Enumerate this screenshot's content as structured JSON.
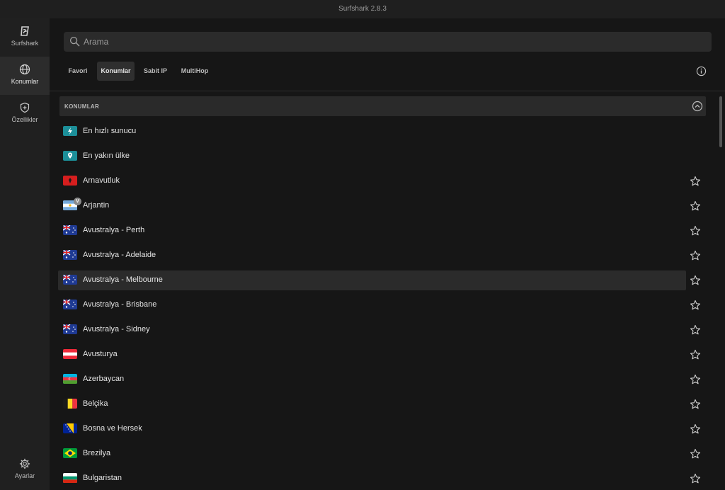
{
  "window": {
    "title": "Surfshark 2.8.3"
  },
  "sidebar": {
    "items": [
      {
        "label": "Surfshark",
        "icon": "surfshark-logo-icon"
      },
      {
        "label": "Konumlar",
        "icon": "globe-icon"
      },
      {
        "label": "Özellikler",
        "icon": "shield-icon"
      },
      {
        "label": "Ayarlar",
        "icon": "gear-icon"
      }
    ]
  },
  "search": {
    "placeholder": "Arama",
    "value": ""
  },
  "tabs": [
    {
      "label": "Favori"
    },
    {
      "label": "Konumlar",
      "active": true
    },
    {
      "label": "Sabit IP"
    },
    {
      "label": "MultiHop"
    }
  ],
  "section": {
    "title": "KONUMLAR"
  },
  "locations": [
    {
      "name": "En hızlı sunucu",
      "icon": "lightning-icon"
    },
    {
      "name": "En yakın ülke",
      "icon": "location-pin-icon"
    },
    {
      "name": "Arnavutluk",
      "flag": "albania"
    },
    {
      "name": "Arjantin",
      "flag": "argentina",
      "badge": "V"
    },
    {
      "name": "Avustralya - Perth",
      "flag": "australia"
    },
    {
      "name": "Avustralya - Adelaide",
      "flag": "australia"
    },
    {
      "name": "Avustralya - Melbourne",
      "flag": "australia",
      "highlighted": true
    },
    {
      "name": "Avustralya - Brisbane",
      "flag": "australia"
    },
    {
      "name": "Avustralya - Sidney",
      "flag": "australia"
    },
    {
      "name": "Avusturya",
      "flag": "austria"
    },
    {
      "name": "Azerbaycan",
      "flag": "azerbaijan"
    },
    {
      "name": "Belçika",
      "flag": "belgium"
    },
    {
      "name": "Bosna ve Hersek",
      "flag": "bosnia"
    },
    {
      "name": "Brezilya",
      "flag": "brazil"
    },
    {
      "name": "Bulgaristan",
      "flag": "bulgaria"
    }
  ],
  "colors": {
    "accent": "#1c8f99",
    "background": "#161616",
    "sidebar": "#202020"
  }
}
